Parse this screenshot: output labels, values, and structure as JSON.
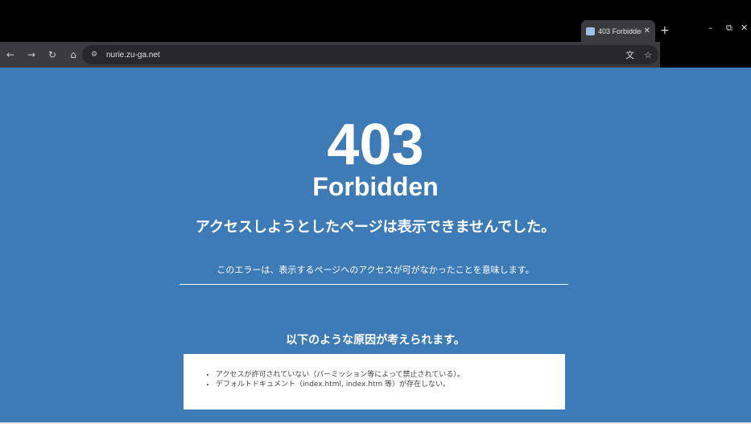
{
  "browser": {
    "tab": {
      "title": "403 Forbidden",
      "close": "✕"
    },
    "new_tab": "+",
    "window_controls": {
      "minimize": "–",
      "maximize": "⧉",
      "close": "✕"
    },
    "nav": {
      "back": "←",
      "forward": "→",
      "reload": "↻",
      "home": "⌂"
    },
    "site_info_icon": "⚙",
    "url": "nurie.zu-ga.net",
    "translate_icon": "文",
    "bookmark_icon": "☆"
  },
  "page": {
    "code": "403",
    "subtitle": "Forbidden",
    "headline": "アクセスしようとしたページは表示できませんでした。",
    "explanation": "このエラーは、表示するページへのアクセスが可がなかったことを意味します。",
    "reasons_title": "以下のような原因が考えられます。",
    "reasons": [
      "アクセスが許可されていない（パーミッション等によって禁止されている）。",
      "デフォルトドキュメント（index.html, index.htm 等）が存在しない。"
    ]
  },
  "colors": {
    "page_bg": "#3d7bb7",
    "toolbar_bg": "#3a3a3f",
    "omnibox_bg": "#28282c"
  }
}
